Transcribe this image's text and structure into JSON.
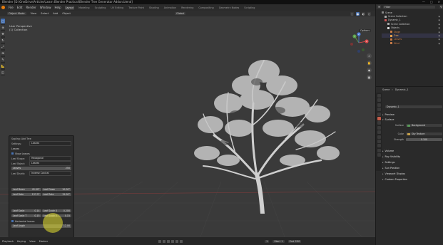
{
  "window": {
    "title": "Blender [D:\\OneDrive\\Articles\\Learn Blender Practical\\Blender Tree Generator Addon.blend]",
    "controls": [
      "—",
      "□",
      "✕"
    ]
  },
  "topbar": {
    "menus": [
      "File",
      "Edit",
      "Render",
      "Window",
      "Help"
    ],
    "workspaces": [
      "Layout",
      "Modeling",
      "Sculpting",
      "UV Editing",
      "Texture Paint",
      "Shading",
      "Animation",
      "Rendering",
      "Compositing",
      "Geometry Nodes",
      "Scripting"
    ],
    "active_workspace": "Layout",
    "scene": "Scene",
    "view_layer": "ViewLayer"
  },
  "viewport": {
    "mode": "Object Mode",
    "menus": [
      "View",
      "Select",
      "Add",
      "Object"
    ],
    "orientation": "Global",
    "view_name": "User Perspective",
    "collection": "(1) Collection",
    "options_label": "Options",
    "gizmo_axes": [
      "X",
      "Y",
      "Z"
    ],
    "tools": [
      "select-box",
      "cursor",
      "move",
      "rotate",
      "scale",
      "transform",
      "annotate",
      "measure",
      "add-cube"
    ],
    "nav_buttons": [
      "zoom",
      "pan",
      "camera",
      "ortho"
    ]
  },
  "sapling": {
    "title": "Sapling: Add Tree",
    "settings_label": "Settings:",
    "settings_value": "Leaves",
    "section": "Leaves",
    "show_leaves_label": "Show Leaves",
    "leaf_shape_label": "Leaf Shape:",
    "leaf_shape_value": "Hexagonal",
    "leaf_object_label": "Leaf Object:",
    "leaf_object_value": "Leaves",
    "leaves_label": "Leaves",
    "leaves_value": "250",
    "leaf_distrib_label": "Leaf Distrib:",
    "leaf_distrib_value": "Inverse Conical",
    "leaf_down_label": "Leaf Down",
    "leaf_down_value": "45.00°",
    "leaf_down2_label": "Leaf Down",
    "leaf_down2_value": "10.00°",
    "leaf_rotate_label": "Leaf Rota",
    "leaf_rotate_value": "137.5°",
    "leaf_rotate2_label": "Leaf Rota",
    "leaf_rotate2_value": "15.00°",
    "leaf_scale_label": "Leaf Scale",
    "leaf_scale_value": "0.14",
    "leaf_scale_x_label": "Leaf Scale X",
    "leaf_scale_x_value": "0.200",
    "leaf_scale_t_label": "Leaf Scale T",
    "leaf_scale_t_value": "0.15",
    "leaf_scale_v_label": "Leaf Scale V",
    "leaf_scale_v_value": "0.15",
    "horizontal_leaves_label": "Horizontal leaves",
    "leaf_angle_label": "Leaf Angle",
    "leaf_angle_value": "12.00"
  },
  "timeline": {
    "playback": "Playback",
    "keying": "Keying",
    "view": "View",
    "marker": "Marker",
    "current_frame": "1",
    "start_label": "Start",
    "start": "1",
    "end_label": "End",
    "end": "250"
  },
  "outliner": {
    "search_placeholder": "Filter",
    "items": [
      {
        "label": "Scene",
        "color": "#c8c8c8"
      },
      {
        "label": "Scene Collection",
        "color": "#c8c8c8"
      },
      {
        "label": "Dynamic_1",
        "color": "#c8c8c8"
      },
      {
        "label": "Scene Collection",
        "color": "#c8c8c8"
      },
      {
        "label": "Objects",
        "color": "#c8c8c8"
      },
      {
        "label": "Stage",
        "color": "#c77a47"
      },
      {
        "label": "Tree",
        "color": "#e8a24a"
      },
      {
        "label": "Leaves",
        "color": "#c77a47"
      },
      {
        "label": "Wind",
        "color": "#c77a47"
      }
    ]
  },
  "properties": {
    "scene_label": "Scene",
    "world_label": "Dynamic_1",
    "world_field": "Dynamic_1",
    "preview": "Preview",
    "surface": "Surface",
    "surface_label": "Surface",
    "surface_value": "Background",
    "color_label": "Color",
    "color_value": "Sky Texture",
    "strength_label": "Strength",
    "strength_value": "0.100",
    "volume": "Volume",
    "ray_visibility": "Ray Visibility",
    "settings": "Settings",
    "sun_position": "Sun Position",
    "viewport_display": "Viewport Display",
    "custom_properties": "Custom Properties"
  },
  "colors": {
    "accent_blue": "#4772b3",
    "blender_orange": "#e87d0d",
    "highlight_yellow": "#e8e232"
  }
}
